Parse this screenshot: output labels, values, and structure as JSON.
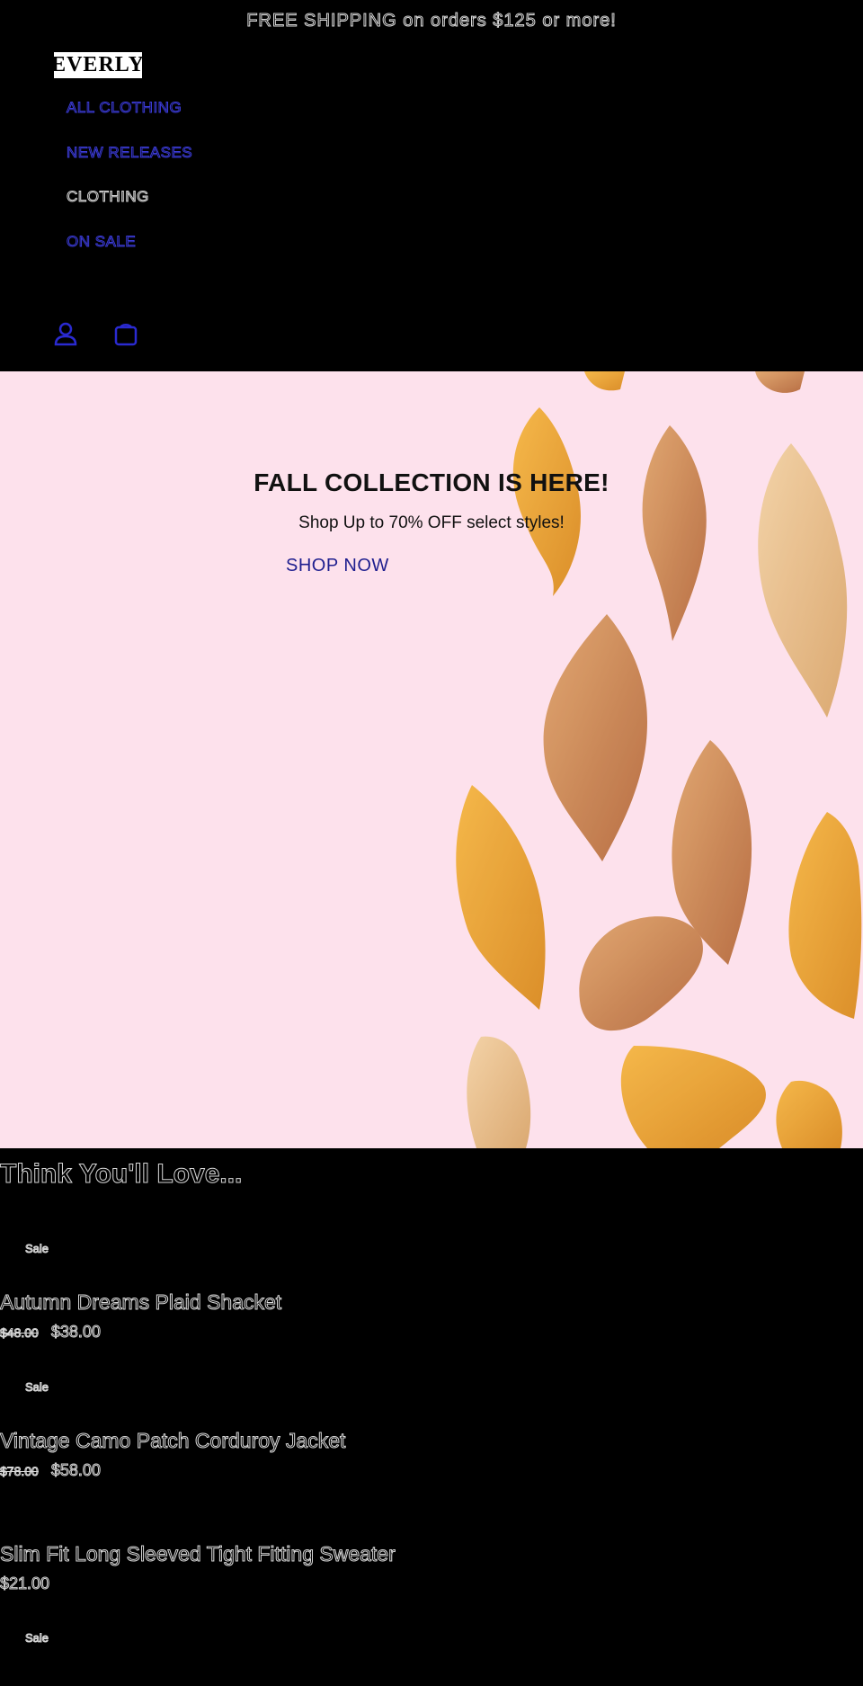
{
  "announcement": "FREE SHIPPING on orders $125 or more!",
  "brand": "EVERLY",
  "nav": [
    {
      "label": "ALL CLOTHING",
      "active": false
    },
    {
      "label": "NEW RELEASES",
      "active": false
    },
    {
      "label": "CLOTHING",
      "active": true
    },
    {
      "label": "ON SALE",
      "active": false
    }
  ],
  "header_icons": [
    "account-icon",
    "cart-icon"
  ],
  "hero": {
    "title": "FALL COLLECTION IS HERE!",
    "subtitle": "Shop Up to 70% OFF select styles!",
    "cta": "SHOP NOW"
  },
  "collection": {
    "title": "Think You'll Love...",
    "products": [
      {
        "badge": "Sale",
        "name": "Autumn Dreams Plaid Shacket",
        "compare_price": "$48.00",
        "price": "$38.00"
      },
      {
        "badge": "Sale",
        "name": "Vintage Camo Patch Corduroy Jacket",
        "compare_price": "$78.00",
        "price": "$58.00"
      },
      {
        "badge": "",
        "name": "Slim Fit Long Sleeved Tight Fitting Sweater",
        "compare_price": "",
        "price": "$21.00"
      },
      {
        "badge": "Sale",
        "name": "",
        "compare_price": "",
        "price": ""
      }
    ]
  },
  "colors": {
    "background": "#000000",
    "hero_bg": "#fde1ec",
    "link_blue": "#3b3bd6",
    "cta_blue": "#1f1f8f"
  }
}
